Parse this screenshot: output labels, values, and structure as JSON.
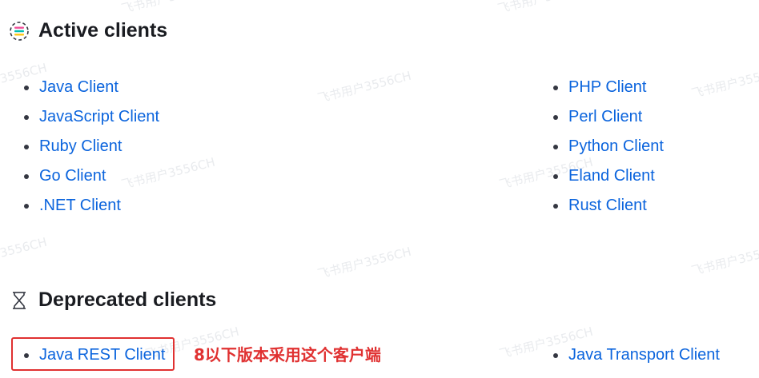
{
  "watermark": "飞书用户3556CH",
  "sections": {
    "active": {
      "title": "Active clients",
      "icon": "plugs-icon",
      "left_list": [
        "Java Client",
        "JavaScript Client",
        "Ruby Client",
        "Go Client",
        ".NET Client"
      ],
      "right_list": [
        "PHP Client",
        "Perl Client",
        "Python Client",
        "Eland Client",
        "Rust Client"
      ]
    },
    "deprecated": {
      "title": "Deprecated clients",
      "icon": "hourglass-icon",
      "left_list": [
        "Java REST Client"
      ],
      "right_list": [
        "Java Transport Client"
      ]
    }
  },
  "annotation": "8以下版本采用这个客户端",
  "colors": {
    "link": "#0b64dd",
    "annotation": "#e03131",
    "heading": "#1a1c21"
  }
}
